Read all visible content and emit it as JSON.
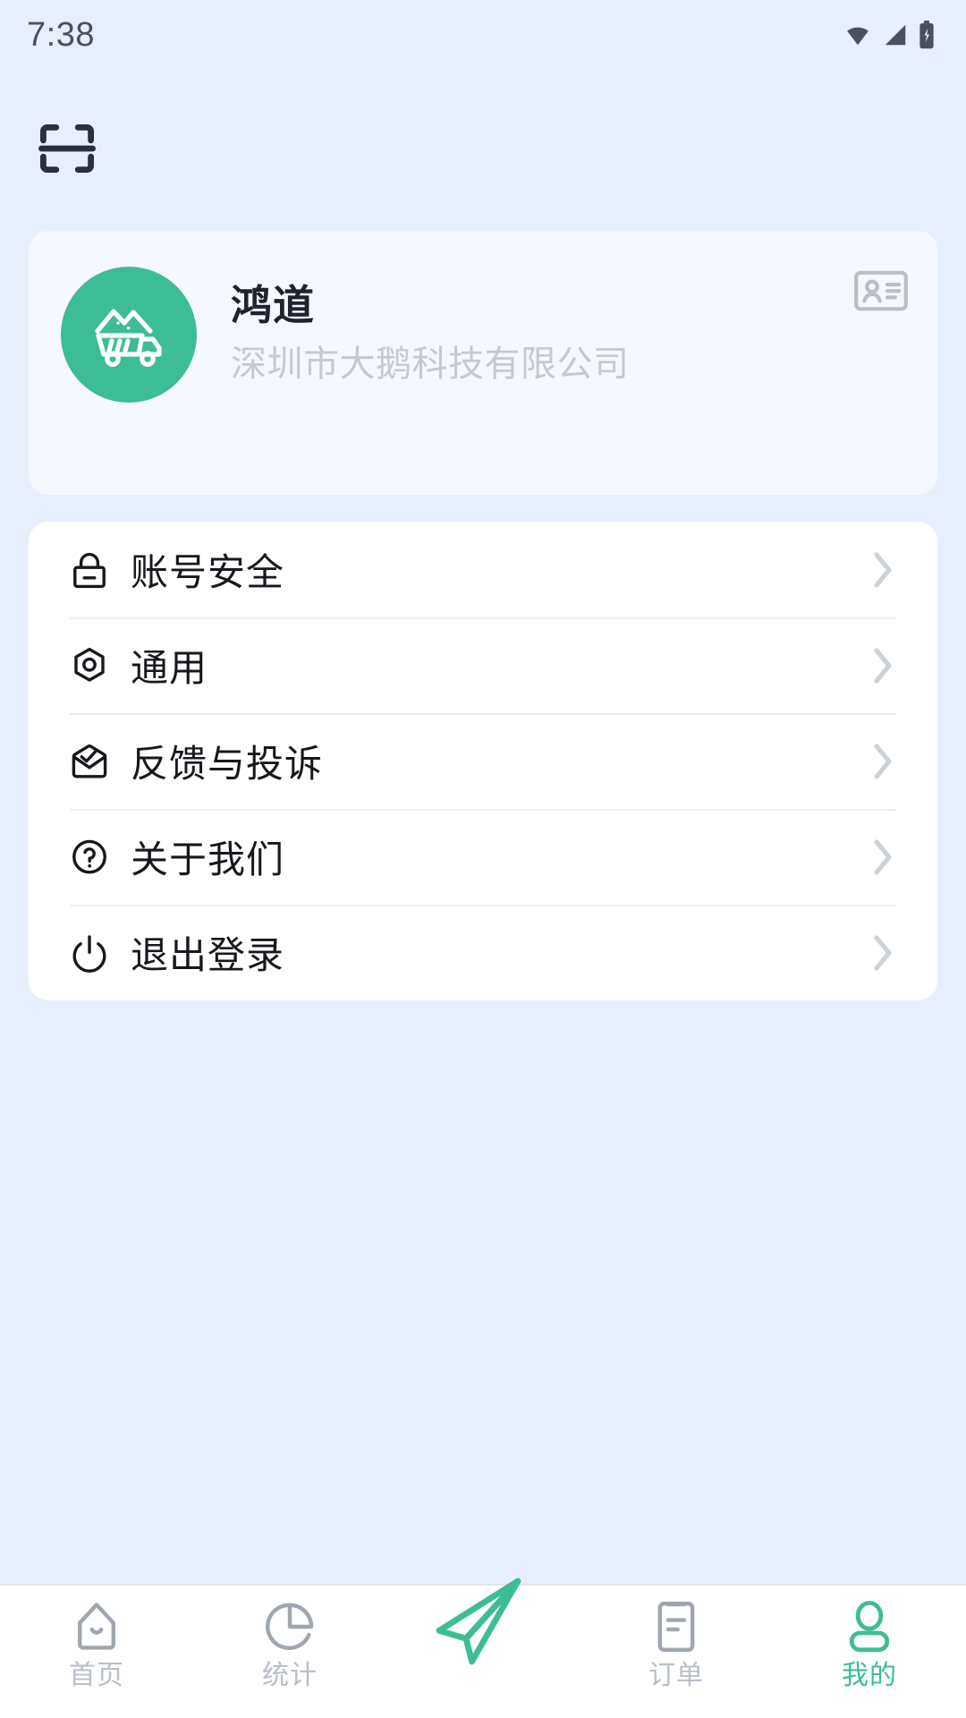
{
  "statusbar": {
    "time": "7:38",
    "icons": [
      "wifi-icon",
      "signal-icon",
      "battery-charging-icon"
    ]
  },
  "header": {
    "scan_icon": "scan-icon"
  },
  "profile": {
    "avatar_icon": "dump-truck-icon",
    "name": "鸿道",
    "company": "深圳市大鹅科技有限公司",
    "id_badge_icon": "id-card-icon",
    "card_bg": "#f5f8fe",
    "avatar_bg": "#3dbd96"
  },
  "menu": {
    "items": [
      {
        "icon": "lock-icon",
        "label": "账号安全",
        "chevron": "chevron-right-icon"
      },
      {
        "icon": "hexagon-gear-icon",
        "label": "通用",
        "chevron": "chevron-right-icon"
      },
      {
        "icon": "envelope-check-icon",
        "label": "反馈与投诉",
        "chevron": "chevron-right-icon"
      },
      {
        "icon": "question-circle-icon",
        "label": "关于我们",
        "chevron": "chevron-right-icon"
      },
      {
        "icon": "power-icon",
        "label": "退出登录",
        "chevron": "chevron-right-icon"
      }
    ]
  },
  "bottom_nav": {
    "active_color": "#3dbd96",
    "inactive_color": "#b9bfc8",
    "items": [
      {
        "icon": "home-icon",
        "label": "首页",
        "active": false
      },
      {
        "icon": "pie-chart-icon",
        "label": "统计",
        "active": false
      },
      {
        "icon": "paper-plane-icon",
        "label": "",
        "active": false
      },
      {
        "icon": "order-document-icon",
        "label": "订单",
        "active": false
      },
      {
        "icon": "person-icon",
        "label": "我的",
        "active": true
      }
    ]
  },
  "colors": {
    "page_bg": "#e7efff",
    "card_white": "#ffffff",
    "divider": "#eceef1",
    "text_primary": "#16181d",
    "text_muted": "#c4c9d2",
    "accent_green": "#3dbd96"
  }
}
